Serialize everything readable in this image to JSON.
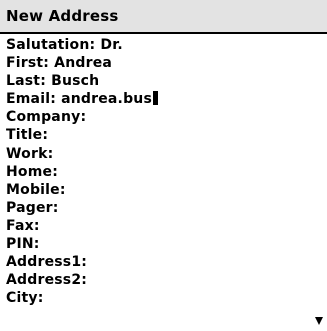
{
  "window": {
    "title": "New Address"
  },
  "form": {
    "fields": [
      {
        "label": "Salutation:",
        "value": "Dr."
      },
      {
        "label": "First:",
        "value": "Andrea"
      },
      {
        "label": "Last:",
        "value": "Busch"
      },
      {
        "label": "Email:",
        "value": "andrea.bus"
      },
      {
        "label": "Company:",
        "value": ""
      },
      {
        "label": "Title:",
        "value": ""
      },
      {
        "label": "Work:",
        "value": ""
      },
      {
        "label": "Home:",
        "value": ""
      },
      {
        "label": "Mobile:",
        "value": ""
      },
      {
        "label": "Pager:",
        "value": ""
      },
      {
        "label": "Fax:",
        "value": ""
      },
      {
        "label": "PIN:",
        "value": ""
      },
      {
        "label": "Address1:",
        "value": ""
      },
      {
        "label": "Address2:",
        "value": ""
      },
      {
        "label": "City:",
        "value": ""
      }
    ]
  },
  "icons": {
    "scroll_down": "scroll-down-arrow-icon",
    "cursor": "text-cursor-icon"
  },
  "colors": {
    "title_bar_bg": "#e3e3e3",
    "background": "#ffffff",
    "text": "#000000"
  }
}
